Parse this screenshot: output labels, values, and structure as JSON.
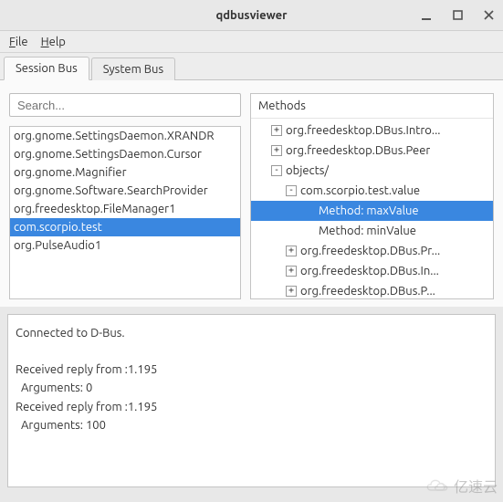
{
  "window": {
    "title": "qdbusviewer"
  },
  "menubar": {
    "file": "File",
    "help": "Help"
  },
  "tabs": {
    "session": "Session Bus",
    "system": "System Bus"
  },
  "search": {
    "placeholder": "Search..."
  },
  "services": [
    "org.gnome.SettingsDaemon.XRANDR",
    "org.gnome.SettingsDaemon.Cursor",
    "org.gnome.Magnifier",
    "org.gnome.Software.SearchProvider",
    "org.freedesktop.FileManager1",
    "com.scorpio.test",
    "org.PulseAudio1"
  ],
  "selected_service_index": 5,
  "methods_pane": {
    "header": "Methods",
    "rows": [
      {
        "depth": 1,
        "exp": "+",
        "label": "org.freedesktop.DBus.Intro...",
        "sel": false
      },
      {
        "depth": 1,
        "exp": "+",
        "label": "org.freedesktop.DBus.Peer",
        "sel": false
      },
      {
        "depth": 1,
        "exp": "-",
        "label": "objects/",
        "sel": false
      },
      {
        "depth": 2,
        "exp": "-",
        "label": "com.scorpio.test.value",
        "sel": false
      },
      {
        "depth": 3,
        "exp": "",
        "label": "Method: maxValue",
        "sel": true
      },
      {
        "depth": 3,
        "exp": "",
        "label": "Method: minValue",
        "sel": false
      },
      {
        "depth": 2,
        "exp": "+",
        "label": "org.freedesktop.DBus.Pr...",
        "sel": false
      },
      {
        "depth": 2,
        "exp": "+",
        "label": "org.freedesktop.DBus.In...",
        "sel": false
      },
      {
        "depth": 2,
        "exp": "+",
        "label": "org.freedesktop.DBus.P...",
        "sel": false
      }
    ]
  },
  "log": "Connected to D-Bus.\n\nReceived reply from :1.195\n  Arguments: 0\nReceived reply from :1.195\n  Arguments: 100",
  "watermark": {
    "text": "亿速云"
  }
}
